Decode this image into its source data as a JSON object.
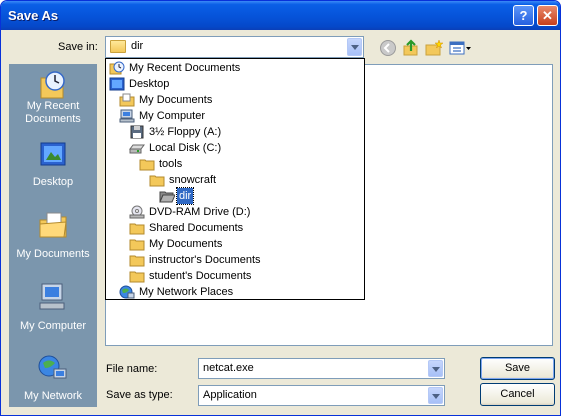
{
  "window": {
    "title": "Save As",
    "help_glyph": "?",
    "close_glyph": "✕"
  },
  "save_in": {
    "label": "Save in:",
    "value": "dir"
  },
  "places": [
    {
      "label": "My Recent Documents",
      "icon": "recent-documents-icon"
    },
    {
      "label": "Desktop",
      "icon": "desktop-icon"
    },
    {
      "label": "My Documents",
      "icon": "my-documents-icon"
    },
    {
      "label": "My Computer",
      "icon": "my-computer-icon"
    },
    {
      "label": "My Network",
      "icon": "my-network-icon"
    }
  ],
  "dropdown": [
    {
      "label": "My Recent Documents",
      "icon": "recent-documents-icon",
      "level": 0,
      "selected": false
    },
    {
      "label": "Desktop",
      "icon": "desktop-icon",
      "level": 0,
      "selected": false
    },
    {
      "label": "My Documents",
      "icon": "my-documents-icon",
      "level": 1,
      "selected": false
    },
    {
      "label": "My Computer",
      "icon": "my-computer-icon",
      "level": 1,
      "selected": false
    },
    {
      "label": "3½ Floppy (A:)",
      "icon": "floppy-icon",
      "level": 2,
      "selected": false
    },
    {
      "label": "Local Disk (C:)",
      "icon": "local-disk-icon",
      "level": 2,
      "selected": false
    },
    {
      "label": "tools",
      "icon": "folder-icon",
      "level": 3,
      "selected": false
    },
    {
      "label": "snowcraft",
      "icon": "folder-icon",
      "level": 4,
      "selected": false
    },
    {
      "label": "dir",
      "icon": "open-folder-icon",
      "level": 5,
      "selected": true
    },
    {
      "label": "DVD-RAM Drive (D:)",
      "icon": "dvd-drive-icon",
      "level": 2,
      "selected": false
    },
    {
      "label": "Shared Documents",
      "icon": "folder-icon",
      "level": 2,
      "selected": false
    },
    {
      "label": "My Documents",
      "icon": "folder-icon",
      "level": 2,
      "selected": false
    },
    {
      "label": "instructor's Documents",
      "icon": "folder-icon",
      "level": 2,
      "selected": false
    },
    {
      "label": "student's Documents",
      "icon": "folder-icon",
      "level": 2,
      "selected": false
    },
    {
      "label": "My Network Places",
      "icon": "network-places-icon",
      "level": 1,
      "selected": false
    }
  ],
  "filename": {
    "label": "File name:",
    "value": "netcat.exe"
  },
  "filetype": {
    "label": "Save as type:",
    "value": "Application"
  },
  "buttons": {
    "save": "Save",
    "cancel": "Cancel"
  },
  "toolbar": [
    "back-icon",
    "up-folder-icon",
    "new-folder-icon",
    "views-menu-icon"
  ],
  "colors": {
    "titlebar": "#0653d9",
    "dialog": "#ece9d8",
    "places_bar": "#7b96ad",
    "selection": "#316ac5"
  }
}
